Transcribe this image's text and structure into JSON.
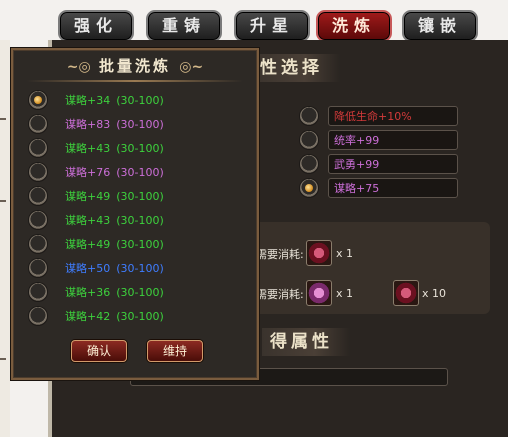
{
  "tabs": [
    "强化",
    "重铸",
    "升星",
    "洗炼",
    "镶嵌"
  ],
  "active_tab_index": 3,
  "main": {
    "section1_title": "性选择",
    "section2_title": "得属性",
    "attributes": [
      {
        "text": "降低生命+10%",
        "color": "#d23a3a",
        "selected": false
      },
      {
        "text": "统率+99",
        "color": "#cc6fd8",
        "selected": false
      },
      {
        "text": "武勇+99",
        "color": "#cc6fd8",
        "selected": false
      },
      {
        "text": "谋略+75",
        "color": "#cc6fd8",
        "selected": true
      }
    ],
    "cost1": {
      "label": "需要消耗:",
      "qty": "x 1"
    },
    "cost2": {
      "label": "需要消耗:",
      "qty1": "x 1",
      "qty2": "x 10"
    }
  },
  "popup": {
    "title": "批量洗炼",
    "options": [
      {
        "name": "谋略",
        "value": "+34",
        "range": "(30-100)",
        "color": "#3dd13d",
        "selected": true
      },
      {
        "name": "谋略",
        "value": "+83",
        "range": "(30-100)",
        "color": "#cc6fd8",
        "selected": false
      },
      {
        "name": "谋略",
        "value": "+43",
        "range": "(30-100)",
        "color": "#3dd13d",
        "selected": false
      },
      {
        "name": "谋略",
        "value": "+76",
        "range": "(30-100)",
        "color": "#cc6fd8",
        "selected": false
      },
      {
        "name": "谋略",
        "value": "+49",
        "range": "(30-100)",
        "color": "#3dd13d",
        "selected": false
      },
      {
        "name": "谋略",
        "value": "+43",
        "range": "(30-100)",
        "color": "#3dd13d",
        "selected": false
      },
      {
        "name": "谋略",
        "value": "+49",
        "range": "(30-100)",
        "color": "#3dd13d",
        "selected": false
      },
      {
        "name": "谋略",
        "value": "+50",
        "range": "(30-100)",
        "color": "#3f7dff",
        "selected": false
      },
      {
        "name": "谋略",
        "value": "+36",
        "range": "(30-100)",
        "color": "#3dd13d",
        "selected": false
      },
      {
        "name": "谋略",
        "value": "+42",
        "range": "(30-100)",
        "color": "#3dd13d",
        "selected": false
      }
    ],
    "confirm_label": "确认",
    "keep_label": "维持"
  }
}
